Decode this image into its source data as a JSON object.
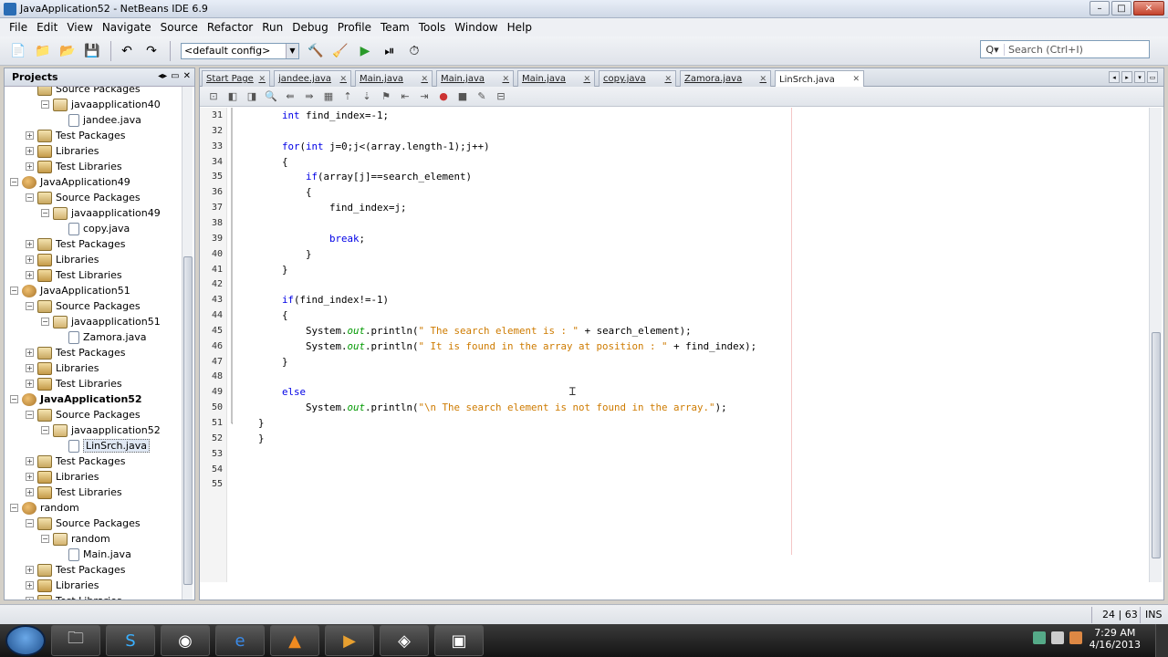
{
  "window": {
    "title": "JavaApplication52 - NetBeans IDE 6.9",
    "min": "–",
    "max": "□",
    "close": "✕"
  },
  "menu": [
    "File",
    "Edit",
    "View",
    "Navigate",
    "Source",
    "Refactor",
    "Run",
    "Debug",
    "Profile",
    "Team",
    "Tools",
    "Window",
    "Help"
  ],
  "toolbar": {
    "config_value": "<default config>",
    "search_placeholder": "Search (Ctrl+I)",
    "search_icon": "Q▾"
  },
  "projects_panel": {
    "title": "Projects",
    "tree": [
      {
        "indent": 2,
        "exp": "",
        "icon": "packages",
        "label": "Source Packages"
      },
      {
        "indent": 3,
        "exp": "−",
        "icon": "package",
        "label": "javaapplication40"
      },
      {
        "indent": 4,
        "exp": "",
        "icon": "file",
        "label": "jandee.java"
      },
      {
        "indent": 2,
        "exp": "+",
        "icon": "packages",
        "label": "Test Packages"
      },
      {
        "indent": 2,
        "exp": "+",
        "icon": "library",
        "label": "Libraries"
      },
      {
        "indent": 2,
        "exp": "+",
        "icon": "library",
        "label": "Test Libraries"
      },
      {
        "indent": 1,
        "exp": "−",
        "icon": "project",
        "label": "JavaApplication49"
      },
      {
        "indent": 2,
        "exp": "−",
        "icon": "packages",
        "label": "Source Packages"
      },
      {
        "indent": 3,
        "exp": "−",
        "icon": "package",
        "label": "javaapplication49"
      },
      {
        "indent": 4,
        "exp": "",
        "icon": "file",
        "label": "copy.java"
      },
      {
        "indent": 2,
        "exp": "+",
        "icon": "packages",
        "label": "Test Packages"
      },
      {
        "indent": 2,
        "exp": "+",
        "icon": "library",
        "label": "Libraries"
      },
      {
        "indent": 2,
        "exp": "+",
        "icon": "library",
        "label": "Test Libraries"
      },
      {
        "indent": 1,
        "exp": "−",
        "icon": "project",
        "label": "JavaApplication51"
      },
      {
        "indent": 2,
        "exp": "−",
        "icon": "packages",
        "label": "Source Packages"
      },
      {
        "indent": 3,
        "exp": "−",
        "icon": "package",
        "label": "javaapplication51"
      },
      {
        "indent": 4,
        "exp": "",
        "icon": "file",
        "label": "Zamora.java"
      },
      {
        "indent": 2,
        "exp": "+",
        "icon": "packages",
        "label": "Test Packages"
      },
      {
        "indent": 2,
        "exp": "+",
        "icon": "library",
        "label": "Libraries"
      },
      {
        "indent": 2,
        "exp": "+",
        "icon": "library",
        "label": "Test Libraries"
      },
      {
        "indent": 1,
        "exp": "−",
        "icon": "project",
        "label": "JavaApplication52",
        "bold": true
      },
      {
        "indent": 2,
        "exp": "−",
        "icon": "packages",
        "label": "Source Packages"
      },
      {
        "indent": 3,
        "exp": "−",
        "icon": "package",
        "label": "javaapplication52"
      },
      {
        "indent": 4,
        "exp": "",
        "icon": "file",
        "label": "LinSrch.java",
        "selected": true
      },
      {
        "indent": 2,
        "exp": "+",
        "icon": "packages",
        "label": "Test Packages"
      },
      {
        "indent": 2,
        "exp": "+",
        "icon": "library",
        "label": "Libraries"
      },
      {
        "indent": 2,
        "exp": "+",
        "icon": "library",
        "label": "Test Libraries"
      },
      {
        "indent": 1,
        "exp": "−",
        "icon": "project",
        "label": "random"
      },
      {
        "indent": 2,
        "exp": "−",
        "icon": "packages",
        "label": "Source Packages"
      },
      {
        "indent": 3,
        "exp": "−",
        "icon": "package",
        "label": "random"
      },
      {
        "indent": 4,
        "exp": "",
        "icon": "file",
        "label": "Main.java"
      },
      {
        "indent": 2,
        "exp": "+",
        "icon": "packages",
        "label": "Test Packages"
      },
      {
        "indent": 2,
        "exp": "+",
        "icon": "library",
        "label": "Libraries"
      },
      {
        "indent": 2,
        "exp": "+",
        "icon": "library",
        "label": "Test Libraries"
      }
    ]
  },
  "editor": {
    "tabs": [
      {
        "label": "Start Page",
        "active": false
      },
      {
        "label": "jandee.java",
        "active": false
      },
      {
        "label": "Main.java",
        "active": false
      },
      {
        "label": "Main.java",
        "active": false
      },
      {
        "label": "Main.java",
        "active": false
      },
      {
        "label": "copy.java",
        "active": false
      },
      {
        "label": "Zamora.java",
        "active": false
      },
      {
        "label": "LinSrch.java",
        "active": true
      }
    ],
    "tab_close": "✕",
    "lines": [
      {
        "n": "31",
        "code": "        int find_index=-1;"
      },
      {
        "n": "32",
        "code": ""
      },
      {
        "n": "33",
        "code": "        for(int j=0;j<(array.length-1);j++)"
      },
      {
        "n": "34",
        "code": "        {"
      },
      {
        "n": "35",
        "code": "            if(array[j]==search_element)"
      },
      {
        "n": "36",
        "code": "            {"
      },
      {
        "n": "37",
        "code": "                find_index=j;"
      },
      {
        "n": "38",
        "code": ""
      },
      {
        "n": "39",
        "code": "                break;"
      },
      {
        "n": "40",
        "code": "            }"
      },
      {
        "n": "41",
        "code": "        }"
      },
      {
        "n": "42",
        "code": ""
      },
      {
        "n": "43",
        "code": "        if(find_index!=-1)"
      },
      {
        "n": "44",
        "code": "        {"
      },
      {
        "n": "45",
        "code": "            System.out.println(\" The search element is : \" + search_element);"
      },
      {
        "n": "46",
        "code": "            System.out.println(\" It is found in the array at position : \" + find_index);"
      },
      {
        "n": "47",
        "code": "        }"
      },
      {
        "n": "48",
        "code": ""
      },
      {
        "n": "49",
        "code": "        else"
      },
      {
        "n": "50",
        "code": "            System.out.println(\"\\n The search element is not found in the array.\");"
      },
      {
        "n": "51",
        "code": "    }"
      },
      {
        "n": "52",
        "code": "    }"
      },
      {
        "n": "53",
        "code": ""
      },
      {
        "n": "54",
        "code": ""
      },
      {
        "n": "55",
        "code": ""
      }
    ]
  },
  "status": {
    "position": "24 | 63",
    "mode": "INS"
  },
  "taskbar": {
    "time": "7:29 AM",
    "date": "4/16/2013"
  },
  "colors": {
    "keyword": "#0000e6",
    "string": "#ce7b00",
    "field": "#009900"
  }
}
